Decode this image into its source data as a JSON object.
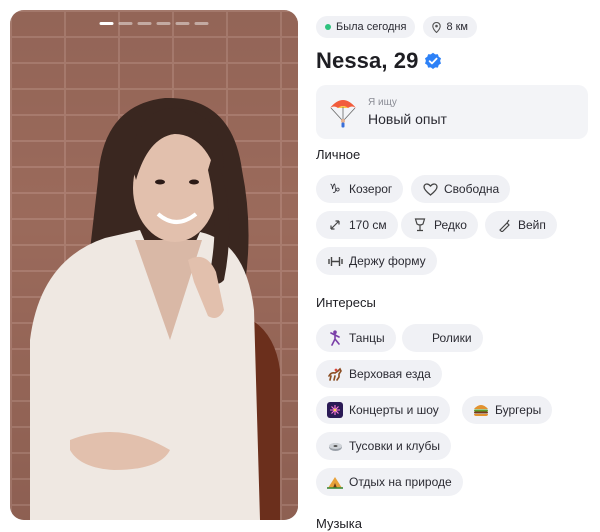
{
  "photo": {
    "indicator_count": 6,
    "active_index": 0
  },
  "status": {
    "last_seen": "Была сегодня",
    "distance": "8 км"
  },
  "profile": {
    "name_age": "Nessa, 29",
    "verified": true
  },
  "goal": {
    "caption": "Я ищу",
    "value": "Новый опыт",
    "icon": "parachute-icon"
  },
  "personal": {
    "title": "Личное",
    "tags": [
      {
        "label": "Козерог",
        "icon": "capricorn-icon"
      },
      {
        "label": "Свободна",
        "icon": "heart-icon"
      },
      {
        "label": "170 см",
        "icon": "height-icon"
      },
      {
        "label": "Редко",
        "icon": "glass-icon"
      },
      {
        "label": "Вейп",
        "icon": "vape-icon"
      },
      {
        "label": "Держу форму",
        "icon": "dumbbell-icon"
      }
    ]
  },
  "interests": {
    "title": "Интересы",
    "tags": [
      {
        "label": "Танцы",
        "icon": "dancer-icon"
      },
      {
        "label": "Ролики",
        "icon": ""
      },
      {
        "label": "Верховая езда",
        "icon": "horse-icon"
      },
      {
        "label": "Концерты и шоу",
        "icon": "fireworks-icon"
      },
      {
        "label": "Бургеры",
        "icon": "burger-icon"
      },
      {
        "label": "Тусовки и клубы",
        "icon": "disco-icon"
      },
      {
        "label": "Отдых на природе",
        "icon": "camping-icon"
      }
    ]
  },
  "music": {
    "title": "Музыка"
  },
  "colors": {
    "accent": "#2d81f7",
    "chip_bg": "#f0f1f5",
    "online": "#2ec27e"
  }
}
